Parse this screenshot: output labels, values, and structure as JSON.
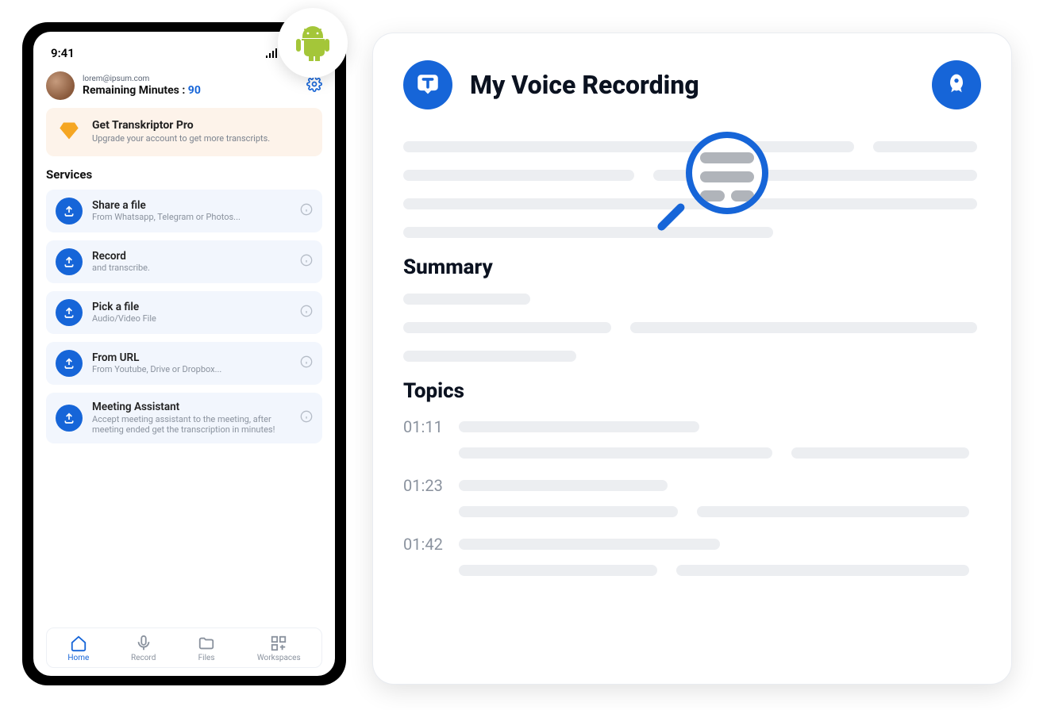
{
  "phone": {
    "status_time": "9:41",
    "email": "lorem@ipsum.com",
    "remaining_label": "Remaining Minutes :",
    "remaining_value": "90",
    "promo": {
      "title": "Get Transkriptor Pro",
      "subtitle": "Upgrade your account to get more transcripts."
    },
    "services_heading": "Services",
    "services": [
      {
        "title": "Share a file",
        "subtitle": "From Whatsapp, Telegram or Photos..."
      },
      {
        "title": "Record",
        "subtitle": "and transcribe."
      },
      {
        "title": "Pick a file",
        "subtitle": "Audio/Video File"
      },
      {
        "title": "From URL",
        "subtitle": "From Youtube, Drive or Dropbox..."
      },
      {
        "title": "Meeting Assistant",
        "subtitle": "Accept meeting assistant to the meeting, after meeting ended get the transcription in minutes!"
      }
    ],
    "tabs": [
      {
        "label": "Home"
      },
      {
        "label": "Record"
      },
      {
        "label": "Files"
      },
      {
        "label": "Workspaces"
      }
    ]
  },
  "panel": {
    "title": "My Voice Recording",
    "summary_heading": "Summary",
    "topics_heading": "Topics",
    "topics": [
      {
        "time": "01:11"
      },
      {
        "time": "01:23"
      },
      {
        "time": "01:42"
      }
    ]
  }
}
